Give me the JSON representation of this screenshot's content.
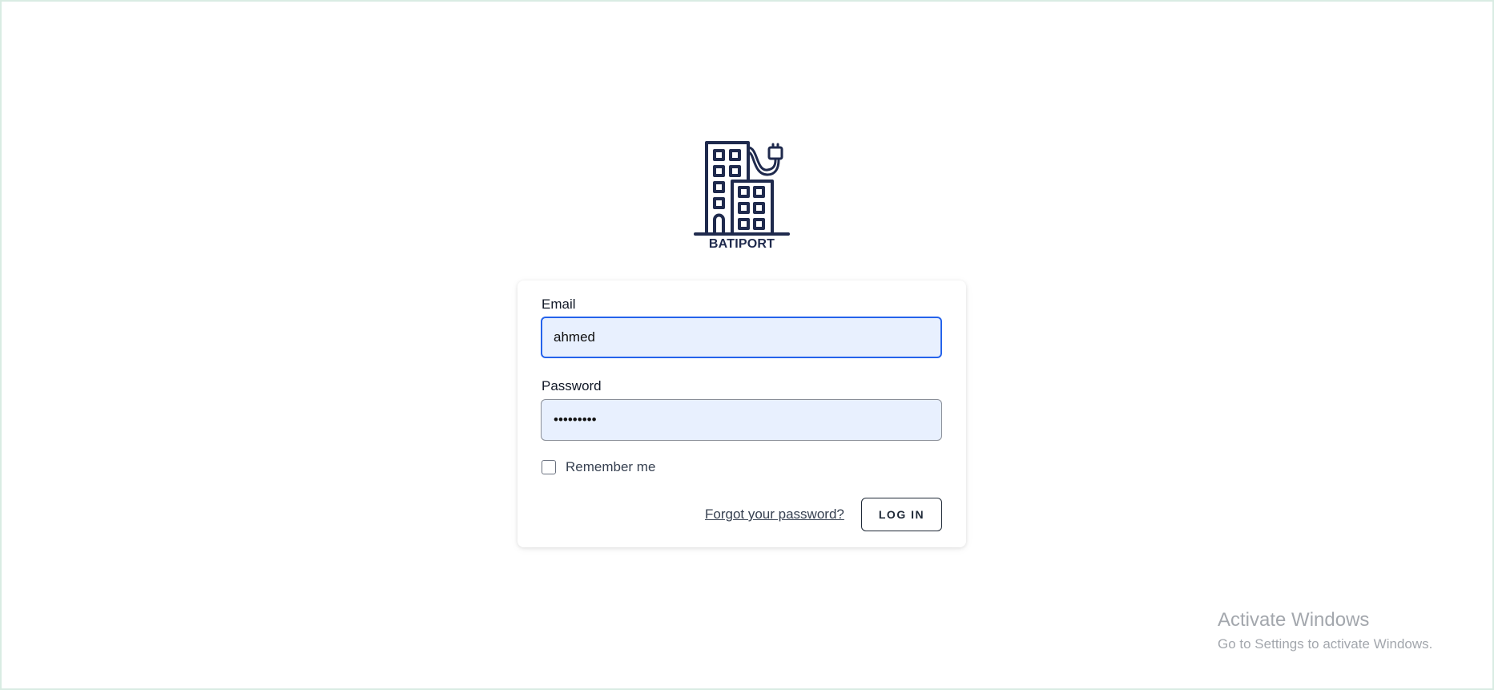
{
  "brand": {
    "name": "BATIPORT",
    "logo_icon": "building-with-plug-icon",
    "color": "#1f2a4d"
  },
  "login_form": {
    "email_label": "Email",
    "email_value": "ahmed",
    "password_label": "Password",
    "password_value": "•••••••••",
    "remember_label": "Remember me",
    "remember_checked": false,
    "forgot_link": "Forgot your password?",
    "login_button": "LOG IN",
    "accent_color": "#2563eb",
    "field_background": "#e8f0fe"
  },
  "watermark": {
    "title": "Activate Windows",
    "subtitle": "Go to Settings to activate Windows."
  }
}
